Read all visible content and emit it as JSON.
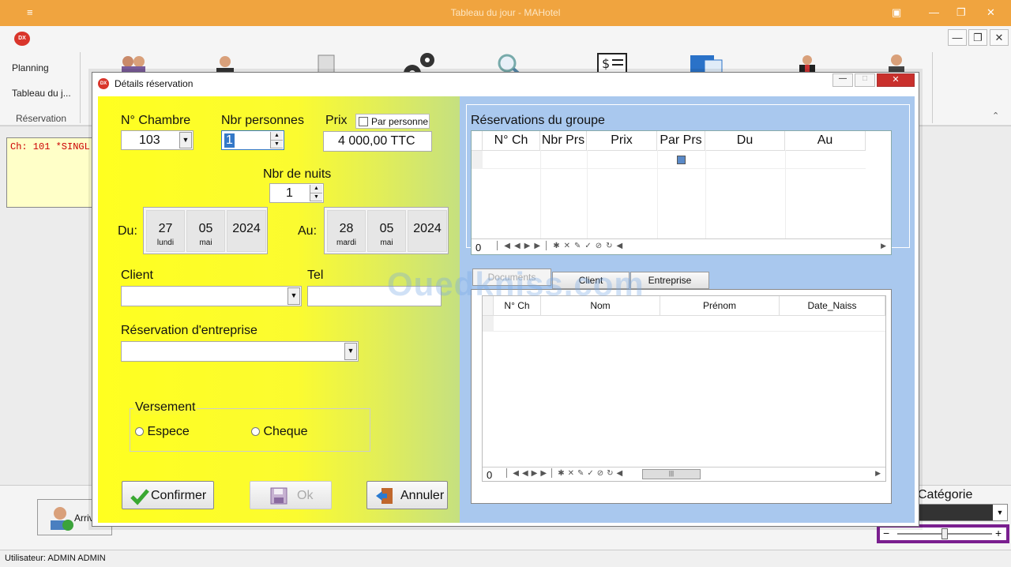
{
  "window": {
    "title": "Tableau du jour - MAHotel",
    "menu_glyph": "≡"
  },
  "app_logo": "DX",
  "ribbon": {
    "nav": [
      "Planning",
      "Tableau du j...",
      "Réservation"
    ]
  },
  "card": {
    "text": "Ch: 101   *SINGL"
  },
  "dialog": {
    "title": "Détails réservation",
    "labels": {
      "chambre": "N° Chambre",
      "nbr_personnes": "Nbr personnes",
      "prix": "Prix",
      "par_personne": "Par personne",
      "nbr_nuits": "Nbr de nuits",
      "du": "Du:",
      "au": "Au:",
      "client": "Client",
      "tel": "Tel",
      "reservation_entreprise": "Réservation d'entreprise",
      "versement": "Versement",
      "espece": "Espece",
      "cheque": "Cheque"
    },
    "values": {
      "chambre": "103",
      "nbr_personnes": "1",
      "prix": "4 000,00 TTC",
      "nbr_nuits": "1",
      "du": {
        "day": "27",
        "weekday": "lundi",
        "month": "05",
        "month_name": "mai",
        "year": "2024"
      },
      "au": {
        "day": "28",
        "weekday": "mardi",
        "month": "05",
        "month_name": "mai",
        "year": "2024"
      }
    },
    "buttons": {
      "confirmer": "Confirmer",
      "ok": "Ok",
      "annuler": "Annuler"
    },
    "group": {
      "title": "Réservations du groupe",
      "columns": [
        "N° Ch",
        "Nbr Prs",
        "Prix",
        "Par Prs",
        "Du",
        "Au"
      ],
      "count": "0"
    },
    "tabs": [
      "Documents",
      "Client",
      "Entreprise"
    ],
    "docs": {
      "columns": [
        "N° Ch",
        "Nom",
        "Prénom",
        "Date_Naiss"
      ],
      "count": "0"
    }
  },
  "watermark": "Ouedkniss.com",
  "bottom": {
    "first_button": "Arriv",
    "categorie_label": "Catégorie"
  },
  "status": {
    "user": "Utilisateur: ADMIN ADMIN"
  },
  "colors": {
    "titlebar": "#f0a43f",
    "panel_yellow": "#ffff20",
    "panel_blue": "#a9c8ee",
    "card_text": "#cc0000"
  }
}
